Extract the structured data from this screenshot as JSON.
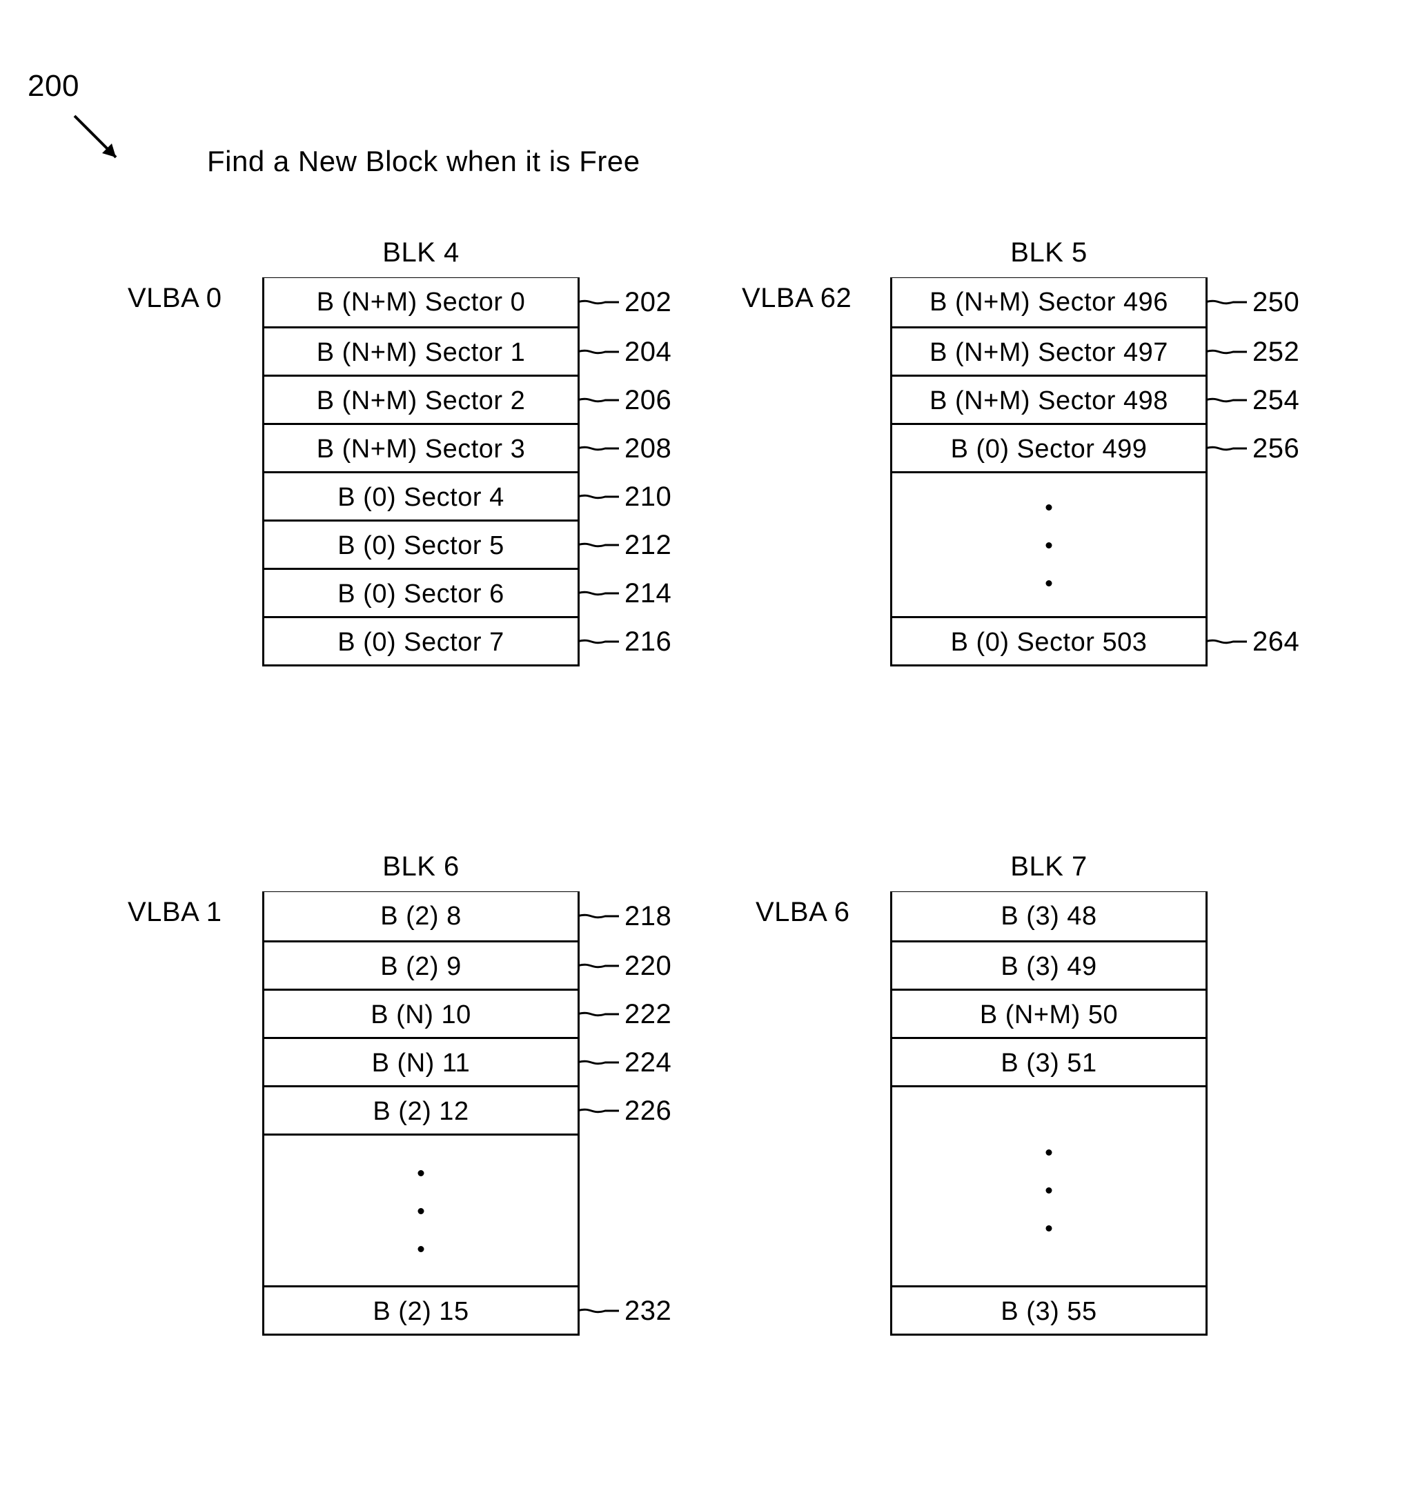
{
  "ref_num": "200",
  "title": "Find a New Block when it is Free",
  "groups": {
    "g0": {
      "vlba": "VLBA 0",
      "blk": "BLK 4",
      "rows": [
        {
          "text": "B (N+M) Sector 0",
          "note": "202"
        },
        {
          "text": "B (N+M) Sector 1",
          "note": "204"
        },
        {
          "text": "B (N+M) Sector 2",
          "note": "206"
        },
        {
          "text": "B (N+M) Sector 3",
          "note": "208"
        },
        {
          "text": "B (0) Sector 4",
          "note": "210"
        },
        {
          "text": "B (0) Sector 5",
          "note": "212"
        },
        {
          "text": "B (0) Sector 6",
          "note": "214"
        },
        {
          "text": "B (0) Sector 7",
          "note": "216"
        }
      ]
    },
    "g1": {
      "vlba": "VLBA 62",
      "blk": "BLK 5",
      "rows_top": [
        {
          "text": "B (N+M) Sector 496",
          "note": "250"
        },
        {
          "text": "B (N+M) Sector 497",
          "note": "252"
        },
        {
          "text": "B (N+M) Sector 498",
          "note": "254"
        },
        {
          "text": "B (0) Sector 499",
          "note": "256"
        }
      ],
      "row_bottom": {
        "text": "B (0) Sector 503",
        "note": "264"
      }
    },
    "g2": {
      "vlba": "VLBA 1",
      "blk": "BLK 6",
      "rows_top": [
        {
          "text": "B (2) 8",
          "note": "218"
        },
        {
          "text": "B (2) 9",
          "note": "220"
        },
        {
          "text": "B (N) 10",
          "note": "222"
        },
        {
          "text": "B (N) 11",
          "note": "224"
        },
        {
          "text": "B (2) 12",
          "note": "226"
        }
      ],
      "row_bottom": {
        "text": "B (2) 15",
        "note": "232"
      }
    },
    "g3": {
      "vlba": "VLBA 6",
      "blk": "BLK 7",
      "rows_top": [
        {
          "text": "B (3) 48"
        },
        {
          "text": "B (3) 49"
        },
        {
          "text": "B (N+M) 50"
        },
        {
          "text": "B (3) 51"
        }
      ],
      "row_bottom": {
        "text": "B (3) 55"
      }
    }
  }
}
